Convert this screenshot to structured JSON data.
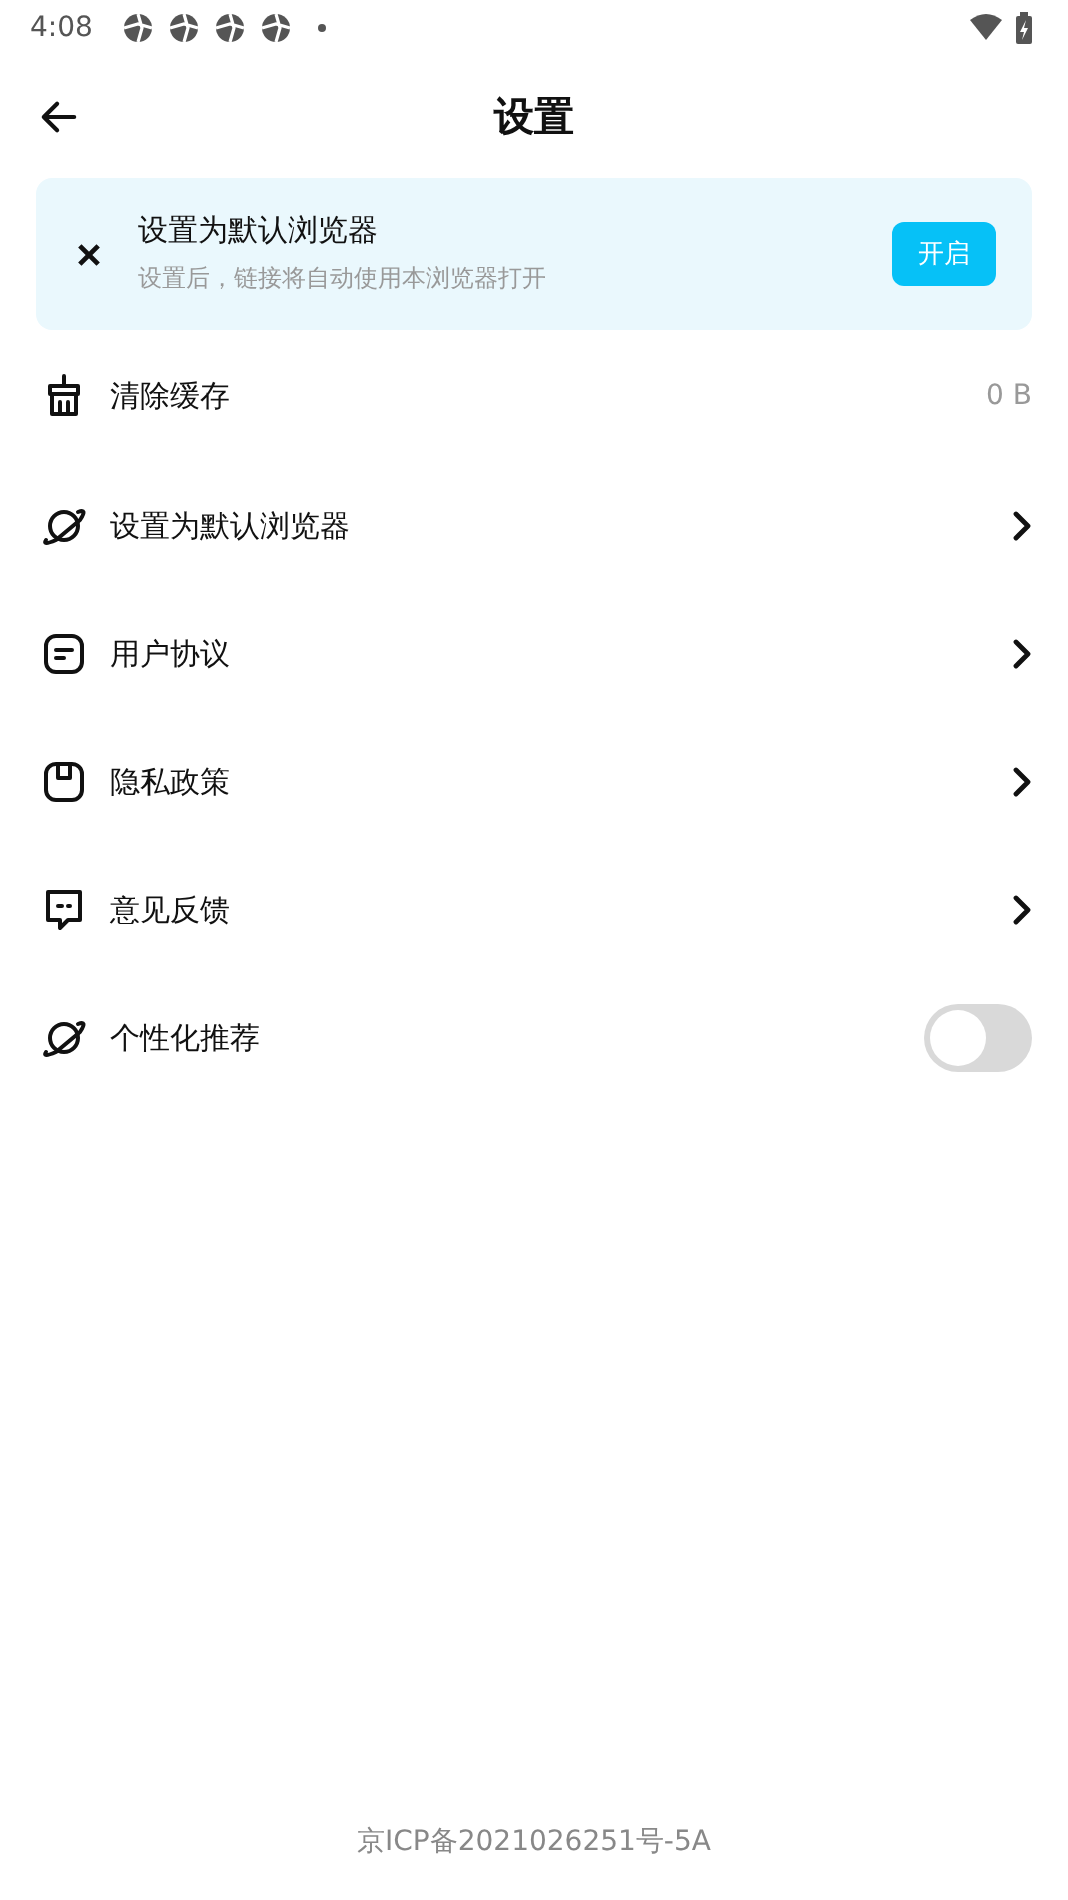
{
  "status_bar": {
    "time": "4:08"
  },
  "header": {
    "title": "设置"
  },
  "banner": {
    "title": "设置为默认浏览器",
    "subtitle": "设置后，链接将自动使用本浏览器打开",
    "button": "开启"
  },
  "items": [
    {
      "kind": "value",
      "label": "清除缓存",
      "value": "0 B"
    },
    {
      "kind": "link",
      "label": "设置为默认浏览器"
    },
    {
      "kind": "link",
      "label": "用户协议"
    },
    {
      "kind": "link",
      "label": "隐私政策"
    },
    {
      "kind": "link",
      "label": "意见反馈"
    },
    {
      "kind": "toggle",
      "label": "个性化推荐",
      "on": false
    }
  ],
  "footer": {
    "text": "京ICP备2021026251号-5A"
  }
}
